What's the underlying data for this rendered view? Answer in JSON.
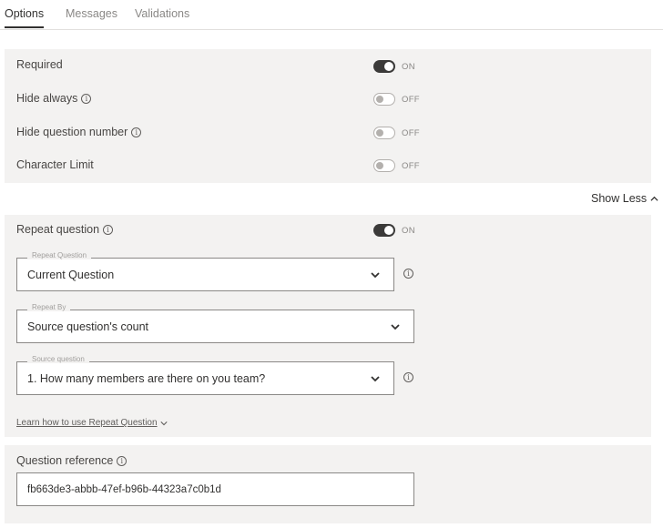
{
  "tabs": [
    {
      "label": "Options"
    },
    {
      "label": "Messages"
    },
    {
      "label": "Validations"
    }
  ],
  "settings": [
    {
      "label": "Required",
      "info": false,
      "state": "ON"
    },
    {
      "label": "Hide always",
      "info": true,
      "state": "OFF"
    },
    {
      "label": "Hide question number",
      "info": true,
      "state": "OFF"
    },
    {
      "label": "Character Limit",
      "info": false,
      "state": "OFF"
    }
  ],
  "show_less_label": "Show Less",
  "repeat": {
    "label": "Repeat question",
    "state": "ON",
    "repeat_question": {
      "label": "Repeat Question",
      "value": "Current Question"
    },
    "repeat_by": {
      "label": "Repeat By",
      "value": "Source question's count"
    },
    "source_question": {
      "label": "Source question",
      "value": "1. How many members are there on you team?"
    },
    "learn_link": "Learn how to use Repeat Question"
  },
  "reference": {
    "label": "Question reference",
    "value": "fb663de3-abbb-47ef-b96b-44323a7c0b1d"
  },
  "icons": {
    "info": "info-icon",
    "chevron": "chevron-down-icon",
    "chevron_up": "chevron-up-icon"
  }
}
